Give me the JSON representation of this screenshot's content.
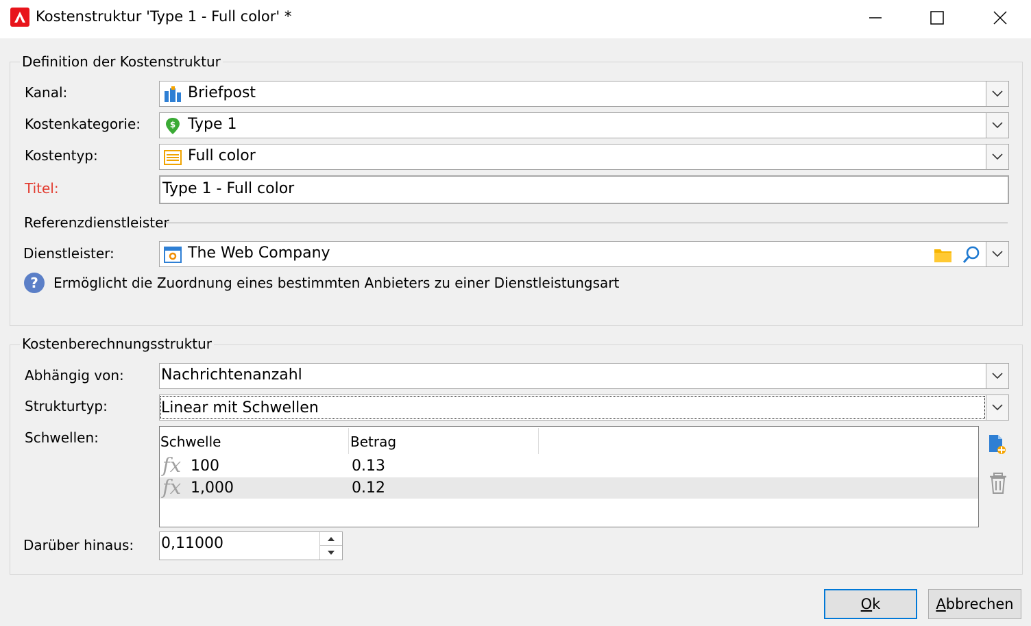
{
  "window": {
    "title": "Kostenstruktur 'Type 1 - Full color' *"
  },
  "definition": {
    "group_title": "Definition der Kostenstruktur",
    "kanal_label": "Kanal:",
    "kanal_value": "Briefpost",
    "kanal_icon": "mailbox-icon",
    "kategorie_label": "Kostenkategorie:",
    "kategorie_value": "Type 1",
    "kategorie_icon": "cost-category-icon",
    "kostentyp_label": "Kostentyp:",
    "kostentyp_value": "Full color",
    "kostentyp_icon": "list-icon",
    "titel_label": "Titel:",
    "titel_value": "Type 1 - Full color",
    "referenz_title": "Referenzdienstleister",
    "dienstleister_label": "Dienstleister:",
    "dienstleister_value": "The Web Company",
    "dienstleister_icon": "service-provider-icon",
    "help_text": "Ermöglicht die Zuordnung eines bestimmten Anbieters zu einer Dienstleistungsart"
  },
  "calculation": {
    "group_title": "Kostenberechnungsstruktur",
    "abhaengig_label": "Abhängig von:",
    "abhaengig_value": "Nachrichtenanzahl",
    "strukturtyp_label": "Strukturtyp:",
    "strukturtyp_value": "Linear mit Schwellen",
    "schwellen_label": "Schwellen:",
    "columns": [
      "Schwelle",
      "Betrag"
    ],
    "rows": [
      {
        "schwelle": "100",
        "betrag": "0.13"
      },
      {
        "schwelle": "1,000",
        "betrag": "0.12"
      }
    ],
    "darueber_label": "Darüber hinaus:",
    "darueber_value": "0,11000"
  },
  "buttons": {
    "ok_first": "O",
    "ok_rest": "k",
    "cancel_first": "A",
    "cancel_rest": "bbrechen"
  },
  "colors": {
    "accent": "#0078d7",
    "required_label": "#e23a2e",
    "app_icon": "#e8141b",
    "dialog_bg": "#f0f0f0"
  }
}
